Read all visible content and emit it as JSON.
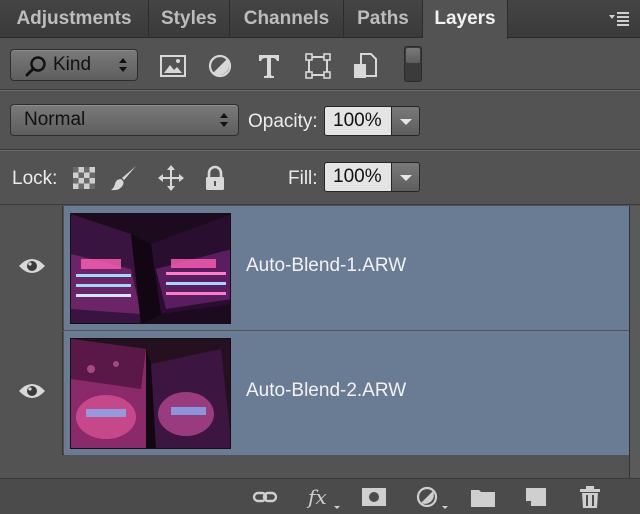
{
  "tabs": [
    {
      "label": "Adjustments",
      "active": false
    },
    {
      "label": "Styles",
      "active": false
    },
    {
      "label": "Channels",
      "active": false
    },
    {
      "label": "Paths",
      "active": false
    },
    {
      "label": "Layers",
      "active": true
    }
  ],
  "filter": {
    "kind_label": "Kind",
    "icons": [
      "image-filter-icon",
      "adjustment-filter-icon",
      "type-filter-icon",
      "shape-filter-icon",
      "smart-object-filter-icon"
    ]
  },
  "blend": {
    "mode": "Normal",
    "opacity_label": "Opacity:",
    "opacity_value": "100%"
  },
  "lock": {
    "label": "Lock:",
    "icons": [
      "lock-transparent-pixels-icon",
      "lock-image-pixels-icon",
      "lock-position-icon",
      "lock-all-icon"
    ],
    "fill_label": "Fill:",
    "fill_value": "100%"
  },
  "layers": [
    {
      "name": "Auto-Blend-1.ARW",
      "visible": true,
      "selected": true
    },
    {
      "name": "Auto-Blend-2.ARW",
      "visible": true,
      "selected": true
    }
  ],
  "bottom_icons": [
    "link-layers-icon",
    "layer-style-fx-icon",
    "add-mask-icon",
    "new-adjustment-layer-icon",
    "new-group-folder-icon",
    "new-layer-icon",
    "delete-layer-trash-icon"
  ],
  "colors": {
    "panel": "#535353",
    "selection": "#6a7c93"
  }
}
